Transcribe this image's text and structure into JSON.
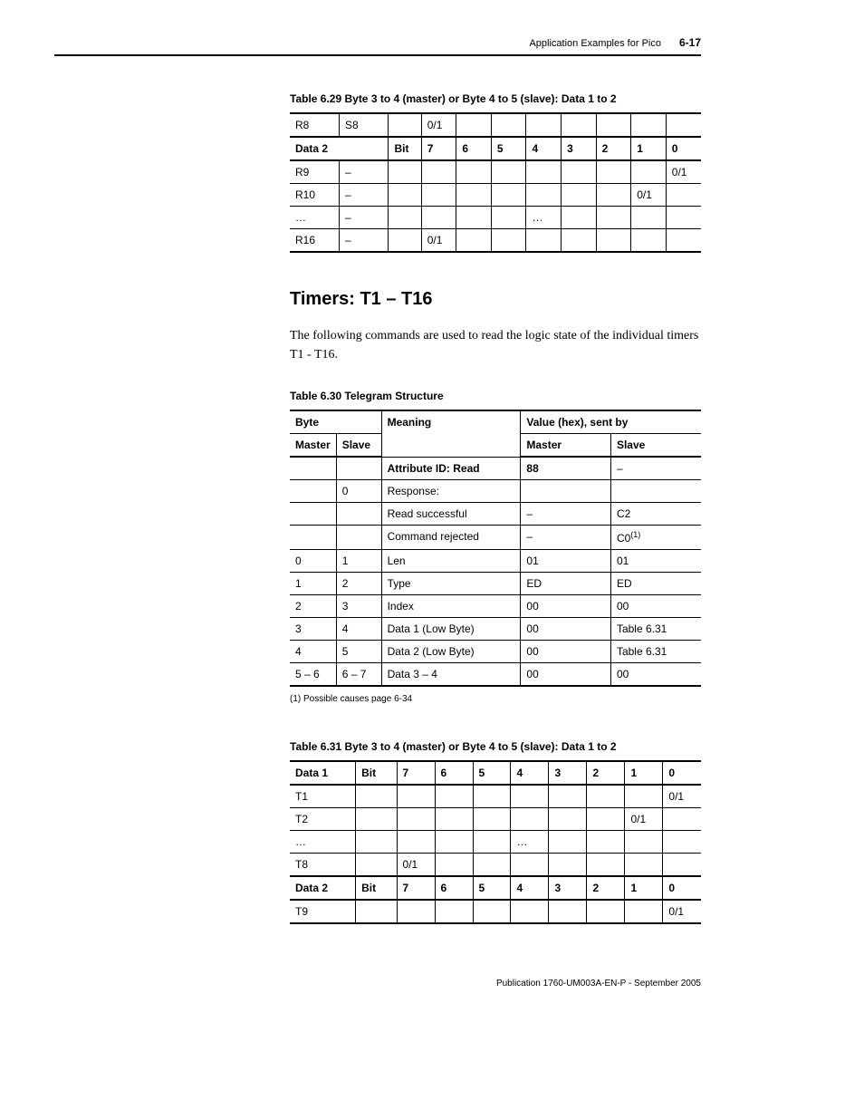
{
  "header": {
    "section_title": "Application Examples for Pico",
    "page_number": "6-17"
  },
  "table629": {
    "caption": "Table 6.29 Byte 3 to 4 (master) or Byte 4 to 5 (slave):  Data 1 to 2",
    "rows": [
      {
        "c0": "R8",
        "c1": "S8",
        "c2": "",
        "c3": "0/1",
        "c4": "",
        "c5": "",
        "c6": "",
        "c7": "",
        "c8": "",
        "c9": "",
        "c10": ""
      },
      {
        "c0": "Data 2",
        "c1": "",
        "c2": "Bit",
        "c3": "7",
        "c4": "6",
        "c5": "5",
        "c6": "4",
        "c7": "3",
        "c8": "2",
        "c9": "1",
        "c10": "0",
        "bold": true
      },
      {
        "c0": "R9",
        "c1": "–",
        "c2": "",
        "c3": "",
        "c4": "",
        "c5": "",
        "c6": "",
        "c7": "",
        "c8": "",
        "c9": "",
        "c10": "0/1"
      },
      {
        "c0": "R10",
        "c1": "–",
        "c2": "",
        "c3": "",
        "c4": "",
        "c5": "",
        "c6": "",
        "c7": "",
        "c8": "",
        "c9": "0/1",
        "c10": ""
      },
      {
        "c0": "…",
        "c1": "–",
        "c2": "",
        "c3": "",
        "c4": "",
        "c5": "",
        "c6": "…",
        "c7": "",
        "c8": "",
        "c9": "",
        "c10": ""
      },
      {
        "c0": "R16",
        "c1": "–",
        "c2": "",
        "c3": "0/1",
        "c4": "",
        "c5": "",
        "c6": "",
        "c7": "",
        "c8": "",
        "c9": "",
        "c10": ""
      }
    ]
  },
  "section": {
    "heading": "Timers: T1 – T16",
    "body": "The following commands are used to read the logic state of the individual timers T1 - T16."
  },
  "table630": {
    "caption": "Table 6.30 Telegram Structure",
    "head_byte": "Byte",
    "head_meaning": "Meaning",
    "head_value": "Value (hex), sent by",
    "head_master": "Master",
    "head_slave": "Slave",
    "rows": [
      {
        "m": "",
        "s": "",
        "meaning": "Attribute ID: Read",
        "vm": "88",
        "vs": "–",
        "bold": true
      },
      {
        "m": "",
        "s": "0",
        "meaning": "Response:",
        "vm": "",
        "vs": ""
      },
      {
        "m": "",
        "s": "",
        "meaning": "Read successful",
        "vm": "–",
        "vs": "C2"
      },
      {
        "m": "",
        "s": "",
        "meaning": "Command rejected",
        "vm": "–",
        "vs": "C0(1)",
        "sup": true
      },
      {
        "m": "0",
        "s": "1",
        "meaning": "Len",
        "vm": "01",
        "vs": "01"
      },
      {
        "m": "1",
        "s": "2",
        "meaning": "Type",
        "vm": "ED",
        "vs": "ED"
      },
      {
        "m": "2",
        "s": "3",
        "meaning": "Index",
        "vm": "00",
        "vs": "00"
      },
      {
        "m": "3",
        "s": "4",
        "meaning": "Data 1 (Low Byte)",
        "vm": "00",
        "vs": "Table 6.31"
      },
      {
        "m": "4",
        "s": "5",
        "meaning": "Data 2 (Low Byte)",
        "vm": "00",
        "vs": "Table 6.31"
      },
      {
        "m": "5 – 6",
        "s": "6 – 7",
        "meaning": "Data 3 – 4",
        "vm": "00",
        "vs": "00"
      }
    ],
    "footnote": "(1)   Possible causes page 6-34"
  },
  "table631": {
    "caption": "Table 6.31 Byte 3 to 4 (master) or Byte 4 to 5 (slave):  Data 1 to 2",
    "rows": [
      {
        "c0": "Data 1",
        "c1": "Bit",
        "c2": "7",
        "c3": "6",
        "c4": "5",
        "c5": "4",
        "c6": "3",
        "c7": "2",
        "c8": "1",
        "c9": "0",
        "bold": true
      },
      {
        "c0": "T1",
        "c1": "",
        "c2": "",
        "c3": "",
        "c4": "",
        "c5": "",
        "c6": "",
        "c7": "",
        "c8": "",
        "c9": "0/1"
      },
      {
        "c0": "T2",
        "c1": "",
        "c2": "",
        "c3": "",
        "c4": "",
        "c5": "",
        "c6": "",
        "c7": "",
        "c8": "0/1",
        "c9": ""
      },
      {
        "c0": "…",
        "c1": "",
        "c2": "",
        "c3": "",
        "c4": "",
        "c5": "…",
        "c6": "",
        "c7": "",
        "c8": "",
        "c9": ""
      },
      {
        "c0": "T8",
        "c1": "",
        "c2": "0/1",
        "c3": "",
        "c4": "",
        "c5": "",
        "c6": "",
        "c7": "",
        "c8": "",
        "c9": ""
      },
      {
        "c0": "Data 2",
        "c1": "Bit",
        "c2": "7",
        "c3": "6",
        "c4": "5",
        "c5": "4",
        "c6": "3",
        "c7": "2",
        "c8": "1",
        "c9": "0",
        "bold": true
      },
      {
        "c0": "T9",
        "c1": "",
        "c2": "",
        "c3": "",
        "c4": "",
        "c5": "",
        "c6": "",
        "c7": "",
        "c8": "",
        "c9": "0/1"
      }
    ]
  },
  "footer": {
    "text": "Publication 1760-UM003A-EN-P - September 2005"
  }
}
